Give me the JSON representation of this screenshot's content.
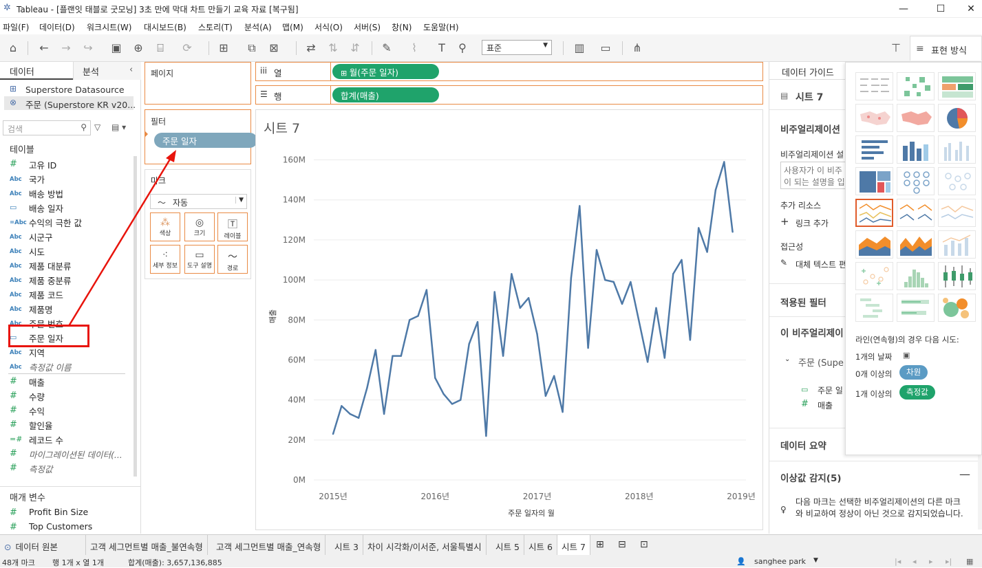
{
  "window": {
    "title": "Tableau - [플랜잇 태블로 굿모닝] 3초 만에 막대 차트 만들기 교육 자료 [복구됨]"
  },
  "menu": [
    "파일(F)",
    "데이터(D)",
    "워크시트(W)",
    "대시보드(B)",
    "스토리(T)",
    "분석(A)",
    "맵(M)",
    "서식(O)",
    "서버(S)",
    "창(N)",
    "도움말(H)"
  ],
  "toolbar": {
    "fit_value": "표준",
    "show_me_label": "표현 방식"
  },
  "left_panel": {
    "tab_data": "데이터",
    "tab_analysis": "분석",
    "datasources": [
      "Superstore Datasource",
      "주문 (Superstore KR v20..."
    ],
    "search_placeholder": "검색",
    "tables_header": "테이블",
    "fields": [
      {
        "icon": "#",
        "name": "고유 ID"
      },
      {
        "icon": "Abc",
        "name": "국가"
      },
      {
        "icon": "Abc",
        "name": "배송 방법"
      },
      {
        "icon": "cal",
        "name": "배송 일자"
      },
      {
        "icon": "=Abc",
        "name": "수익의 극한 값"
      },
      {
        "icon": "Abc",
        "name": "시군구"
      },
      {
        "icon": "Abc",
        "name": "시도"
      },
      {
        "icon": "Abc",
        "name": "제품 대분류"
      },
      {
        "icon": "Abc",
        "name": "제품 중분류"
      },
      {
        "icon": "Abc",
        "name": "제품 코드"
      },
      {
        "icon": "Abc",
        "name": "제품명"
      },
      {
        "icon": "Abc",
        "name": "주문 번호"
      },
      {
        "icon": "cal",
        "name": "주문 일자"
      },
      {
        "icon": "Abc",
        "name": "지역"
      },
      {
        "icon": "Abc",
        "name": "측정값 이름"
      }
    ],
    "measures": [
      {
        "icon": "#",
        "name": "매출"
      },
      {
        "icon": "#",
        "name": "수량"
      },
      {
        "icon": "#",
        "name": "수익"
      },
      {
        "icon": "#",
        "name": "할인율"
      },
      {
        "icon": "=#",
        "name": "레코드 수"
      },
      {
        "icon": "#",
        "name": "마이그레이션된 데이터(..."
      },
      {
        "icon": "#",
        "name": "측정값"
      }
    ],
    "params_header": "매개 변수",
    "params": [
      {
        "icon": "#",
        "name": "Profit Bin Size"
      },
      {
        "icon": "#",
        "name": "Top Customers"
      }
    ]
  },
  "shelves": {
    "pages_label": "페이지",
    "filters_label": "필터",
    "filter_pill": "주문 일자",
    "marks_label": "마크",
    "mark_type": "자동",
    "mark_buttons": [
      "색상",
      "크기",
      "레이블",
      "세부 정보",
      "도구 설명",
      "경로"
    ],
    "columns_label": "열",
    "rows_label": "행",
    "columns_pill": "월(주문 일자)",
    "rows_pill": "합계(매출)"
  },
  "viz": {
    "sheet_title": "시트 7"
  },
  "chart_data": {
    "type": "line",
    "title": "시트 7",
    "xlabel": "주문 일자의 월",
    "ylabel": "매출",
    "x_ticks": [
      "2015년",
      "2016년",
      "2017년",
      "2018년",
      "2019년"
    ],
    "y_ticks": [
      "0M",
      "20M",
      "40M",
      "60M",
      "80M",
      "100M",
      "120M",
      "140M",
      "160M"
    ],
    "ylim": [
      0,
      165
    ],
    "grid": true,
    "color": "#4e79a7",
    "x_start": "2015-01",
    "x_end": "2018-12",
    "values": [
      23,
      37,
      33,
      31,
      46,
      65,
      33,
      62,
      62,
      80,
      82,
      95,
      51,
      43,
      38,
      40,
      68,
      79,
      22,
      94,
      62,
      103,
      86,
      91,
      73,
      42,
      52,
      34,
      101,
      137,
      66,
      115,
      100,
      99,
      88,
      99,
      79,
      59,
      86,
      61,
      103,
      110,
      70,
      126,
      114,
      145,
      159,
      124
    ]
  },
  "right_panel": {
    "title": "데이터 가이드",
    "sheet": "시트 7",
    "viz_desc_header": "비주얼리제이션",
    "viz_desc_sub": "비주얼리제이션 설",
    "viz_desc_placeholder_1": "사용자가 이 비주",
    "viz_desc_placeholder_2": "이 되는 설명을 입",
    "resources": "추가 리소스",
    "add_link": "링크 추가",
    "accessibility": "접근성",
    "alt_text": "대체 텍스트 편",
    "applied_filters": "적용된 필터",
    "this_viz": "이 비주얼리제이",
    "filter_group": "주문 (Supe",
    "filter_item_1": "주문 일",
    "filter_item_2": "매출",
    "data_summary": "데이터 요약",
    "outliers": "이상값 감지(5)",
    "outlier_desc": "다음 마크는 선택한 비주얼리제이션의 다른 마크와 비교하여 정상이 아닌 것으로 감지되었습니다."
  },
  "show_me": {
    "hint": "라인(연속형)의 경우 다음 시도:",
    "req1": "1개의 날짜",
    "req2_prefix": "0개 이상의",
    "req2_pill": "차원",
    "req3_prefix": "1개 이상의",
    "req3_pill": "측정값"
  },
  "sheet_tabs": [
    "데이터 원본",
    "고객 세그먼트별 매출_불연속형",
    "고객 세그먼트별 매출_연속형",
    "시트 3",
    "차이 시각화/이서준, 서울특별시",
    "시트 5",
    "시트 6",
    "시트 7"
  ],
  "status": {
    "marks": "48개 마크",
    "rows_cols": "행 1개 x 열 1개",
    "sum": "합계(매출): 3,657,136,885",
    "user": "sanghee park"
  },
  "colors": {
    "accent_orange": "#e98a44",
    "pill_green": "#1fa36b",
    "pill_blue": "#7fa7bc",
    "line": "#4e79a7",
    "annotation_red": "#e8140c"
  }
}
